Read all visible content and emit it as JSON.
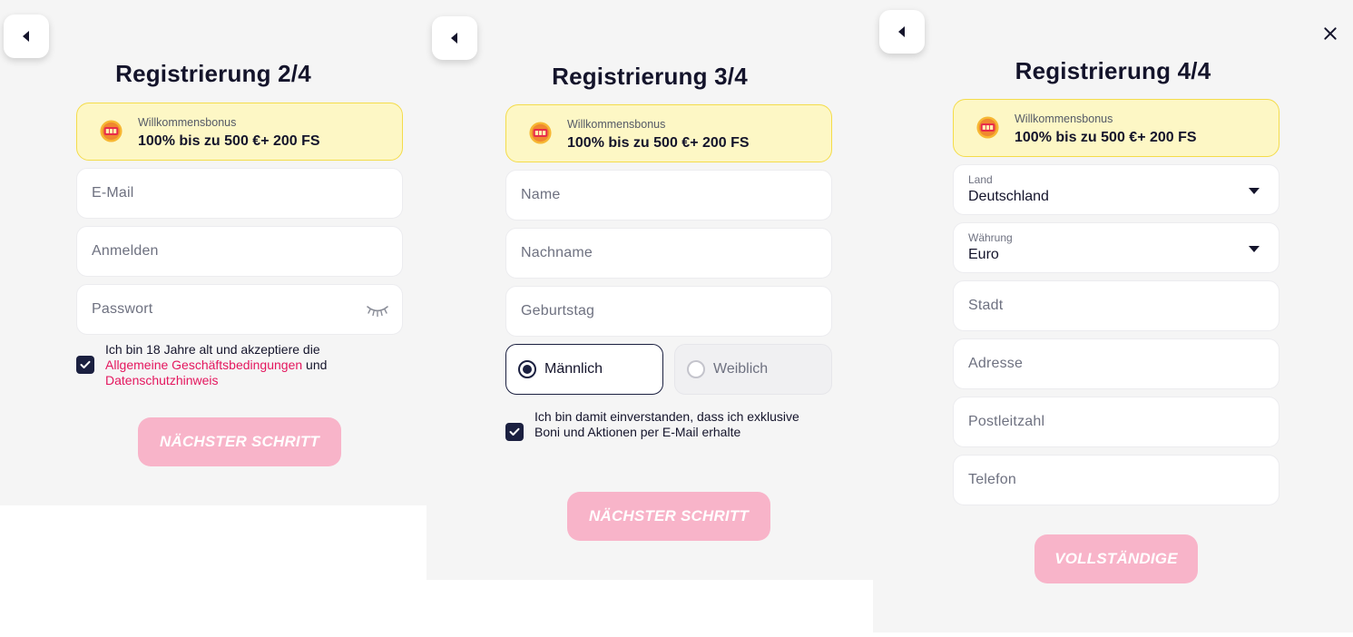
{
  "common": {
    "bonus_label": "Willkommensbonus",
    "bonus_value": "100% bis zu 500 €+ 200 FS"
  },
  "step2": {
    "title": "Registrierung 2/4",
    "email_placeholder": "E-Mail",
    "login_placeholder": "Anmelden",
    "password_placeholder": "Passwort",
    "terms_prefix": "Ich bin 18 Jahre alt und akzeptiere die",
    "terms_link": "Allgemeine Geschäftsbedingungen",
    "terms_and": " und",
    "privacy_link": "Datenschutzhinweis",
    "next_button": "NÄCHSTER SCHRITT"
  },
  "step3": {
    "title": "Registrierung 3/4",
    "name_placeholder": "Name",
    "surname_placeholder": "Nachname",
    "birthday_placeholder": "Geburtstag",
    "gender_male": "Männlich",
    "gender_female": "Weiblich",
    "consent_text": "Ich bin damit einverstanden, dass ich exklusive Boni und Aktionen per E-Mail erhalte",
    "next_button": "NÄCHSTER SCHRITT"
  },
  "step4": {
    "title": "Registrierung 4/4",
    "country_label": "Land",
    "country_value": "Deutschland",
    "currency_label": "Währung",
    "currency_value": "Euro",
    "city_placeholder": "Stadt",
    "address_placeholder": "Adresse",
    "zip_placeholder": "Postleitzahl",
    "phone_placeholder": "Telefon",
    "complete_button": "VOLLSTÄNDIGE"
  },
  "colors": {
    "panel_bg": "#f5f5f5",
    "bonus_bg": "#fdf7c5",
    "bonus_border": "#f4dc4a",
    "link": "#e4175e",
    "cta_disabled": "#f8b4c9",
    "dark": "#1b2040"
  }
}
